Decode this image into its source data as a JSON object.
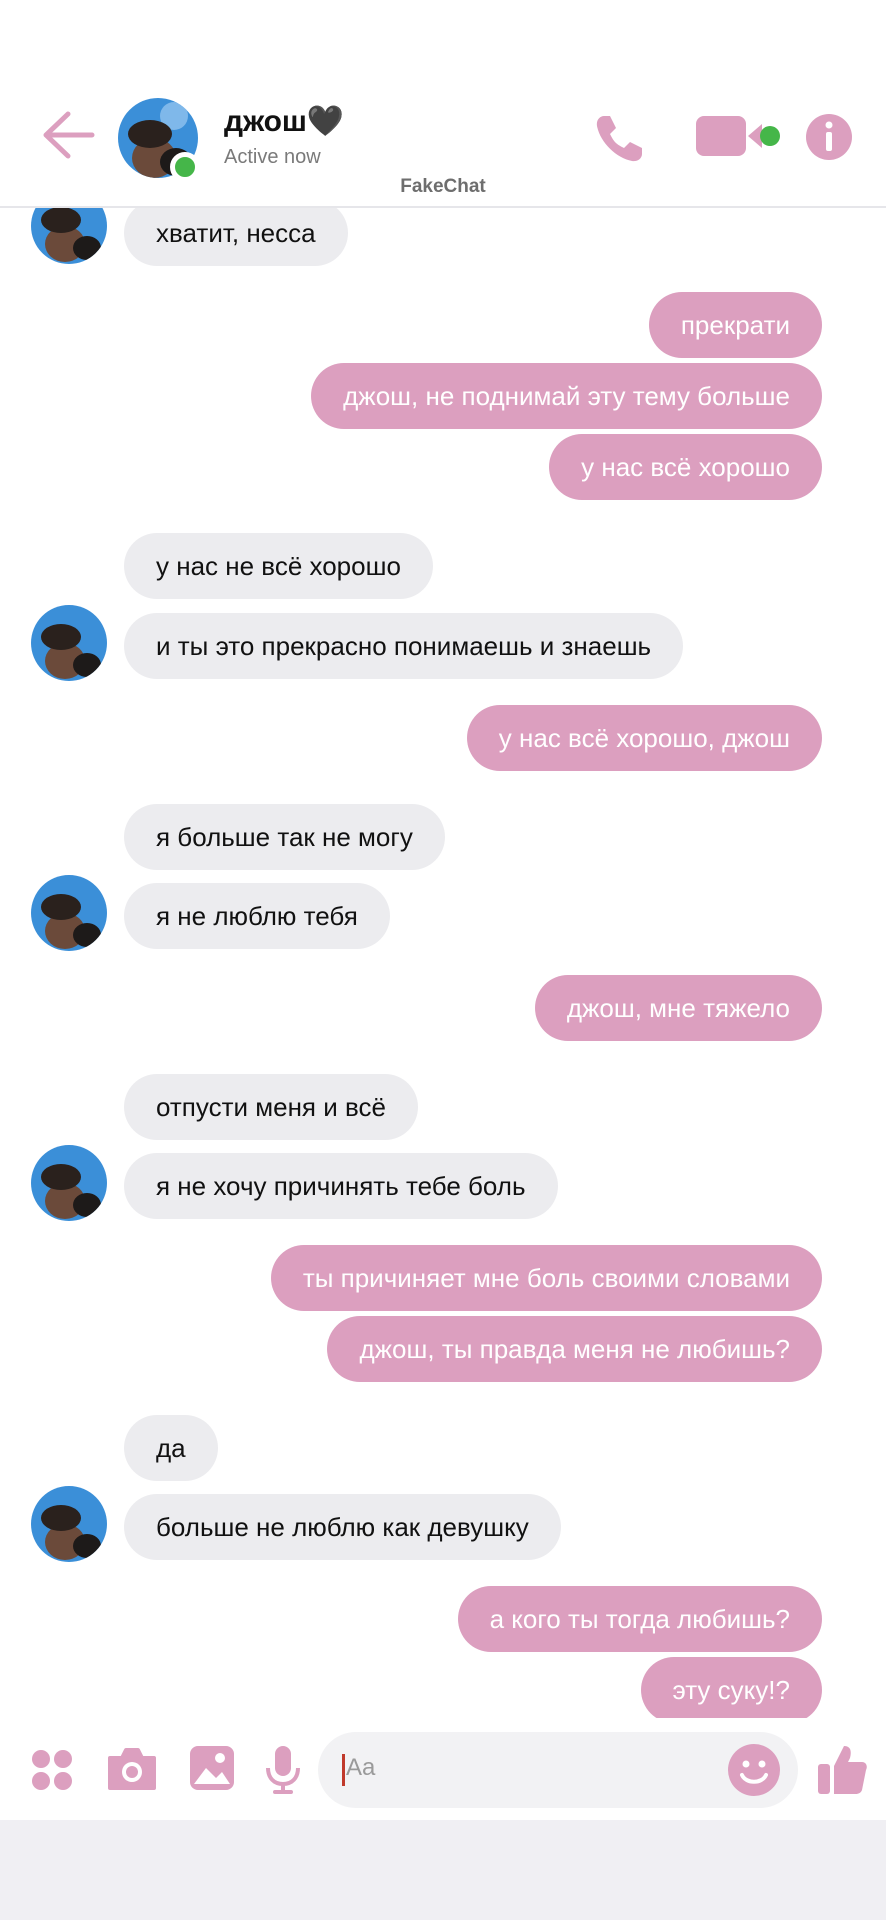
{
  "header": {
    "contact_name": "джош🖤",
    "status": "Active now",
    "brand": "FakeChat"
  },
  "messages": [
    {
      "dir": "in",
      "text": "хватит, несса"
    },
    {
      "dir": "out",
      "text": "прекрати"
    },
    {
      "dir": "out",
      "text": "джош, не поднимай эту тему больше"
    },
    {
      "dir": "out",
      "text": "у нас всё хорошо"
    },
    {
      "dir": "in",
      "text": "у нас не всё хорошо"
    },
    {
      "dir": "in",
      "text": "и ты это прекрасно понимаешь и знаешь"
    },
    {
      "dir": "out",
      "text": "у нас всё хорошо, джош"
    },
    {
      "dir": "in",
      "text": "я больше так не могу"
    },
    {
      "dir": "in",
      "text": "я не люблю тебя"
    },
    {
      "dir": "out",
      "text": "джош, мне тяжело"
    },
    {
      "dir": "in",
      "text": "отпусти меня и всё"
    },
    {
      "dir": "in",
      "text": "я не хочу причинять тебе боль"
    },
    {
      "dir": "out",
      "text": "ты причиняет мне боль своими словами"
    },
    {
      "dir": "out",
      "text": "джош, ты правда меня не любишь?"
    },
    {
      "dir": "in",
      "text": "да"
    },
    {
      "dir": "in",
      "text": "больше не люблю как девушку"
    },
    {
      "dir": "out",
      "text": "а кого ты тогда любишь?"
    },
    {
      "dir": "out",
      "text": "эту суку!?"
    }
  ],
  "composer": {
    "placeholder": "Aa"
  },
  "theme": {
    "accent": "#dc9fbf",
    "incoming_bubble": "#ececef",
    "online": "#45b649"
  },
  "icons": [
    "back-arrow-icon",
    "phone-icon",
    "video-camera-icon",
    "info-icon",
    "apps-grid-icon",
    "camera-icon",
    "gallery-icon",
    "microphone-icon",
    "emoji-icon",
    "thumbs-up-icon"
  ]
}
